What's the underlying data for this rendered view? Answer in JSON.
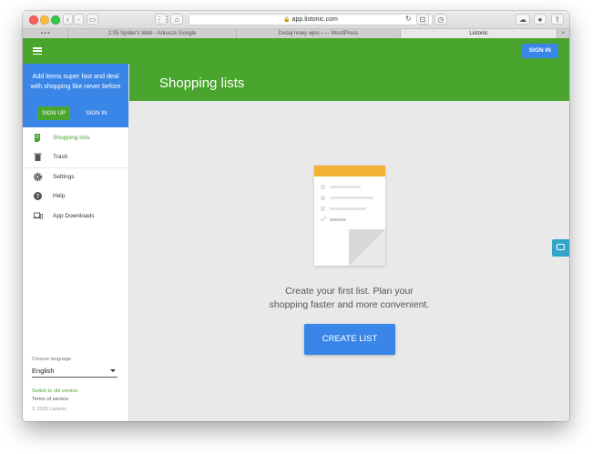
{
  "browser": {
    "url": "app.listonic.com",
    "tabs": [
      {
        "label": "2.05 Spider's Web - Arkusze Google",
        "active": false
      },
      {
        "label": "Dodaj nowy wpis ‹ — WordPress",
        "active": false
      },
      {
        "label": "Listonic",
        "active": true
      }
    ]
  },
  "topbar": {
    "signin_label": "SIGN IN",
    "brand_color": "#4aa52e",
    "accent_color": "#3a86e8"
  },
  "sidebar": {
    "promo_text": "Add items super fast and deal with shopping like never before",
    "signup_label": "SIGN UP",
    "signin_label": "SIGN IN",
    "items": [
      {
        "label": "Shopping lists",
        "icon": "list-icon",
        "active": true
      },
      {
        "label": "Trash",
        "icon": "trash-icon",
        "active": false
      },
      {
        "label": "Settings",
        "icon": "gear-icon",
        "active": false
      },
      {
        "label": "Help",
        "icon": "help-icon",
        "active": false
      },
      {
        "label": "App Downloads",
        "icon": "devices-icon",
        "active": false
      }
    ],
    "language_label": "Choose language",
    "language_value": "English",
    "old_version_link": "Switch to old version",
    "terms_link": "Terms of service",
    "copyright": "© 2015 Listonic"
  },
  "header": {
    "title": "Shopping lists"
  },
  "main": {
    "empty_line1": "Create your first list. Plan your",
    "empty_line2": "shopping faster and more convenient.",
    "create_label": "CREATE LIST"
  }
}
